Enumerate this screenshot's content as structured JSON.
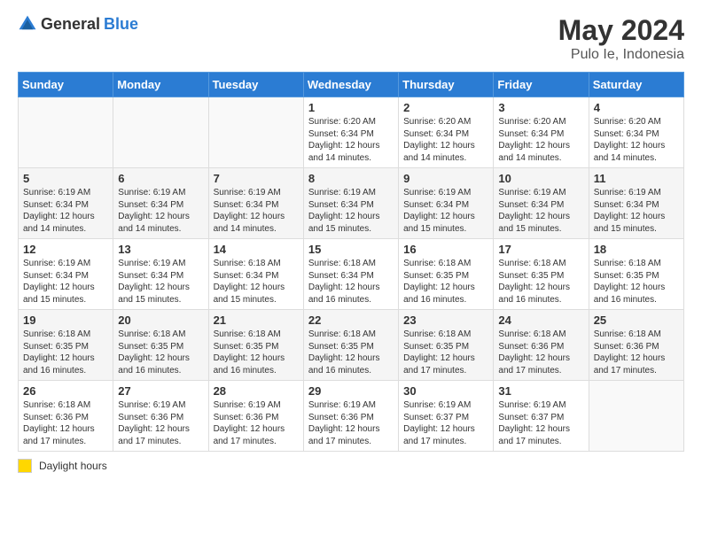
{
  "logo": {
    "general": "General",
    "blue": "Blue"
  },
  "title": "May 2024",
  "subtitle": "Pulo Ie, Indonesia",
  "days_header": [
    "Sunday",
    "Monday",
    "Tuesday",
    "Wednesday",
    "Thursday",
    "Friday",
    "Saturday"
  ],
  "weeks": [
    [
      {
        "day": "",
        "sunrise": "",
        "sunset": "",
        "daylight": ""
      },
      {
        "day": "",
        "sunrise": "",
        "sunset": "",
        "daylight": ""
      },
      {
        "day": "",
        "sunrise": "",
        "sunset": "",
        "daylight": ""
      },
      {
        "day": "1",
        "sunrise": "Sunrise: 6:20 AM",
        "sunset": "Sunset: 6:34 PM",
        "daylight": "Daylight: 12 hours and 14 minutes."
      },
      {
        "day": "2",
        "sunrise": "Sunrise: 6:20 AM",
        "sunset": "Sunset: 6:34 PM",
        "daylight": "Daylight: 12 hours and 14 minutes."
      },
      {
        "day": "3",
        "sunrise": "Sunrise: 6:20 AM",
        "sunset": "Sunset: 6:34 PM",
        "daylight": "Daylight: 12 hours and 14 minutes."
      },
      {
        "day": "4",
        "sunrise": "Sunrise: 6:20 AM",
        "sunset": "Sunset: 6:34 PM",
        "daylight": "Daylight: 12 hours and 14 minutes."
      }
    ],
    [
      {
        "day": "5",
        "sunrise": "Sunrise: 6:19 AM",
        "sunset": "Sunset: 6:34 PM",
        "daylight": "Daylight: 12 hours and 14 minutes."
      },
      {
        "day": "6",
        "sunrise": "Sunrise: 6:19 AM",
        "sunset": "Sunset: 6:34 PM",
        "daylight": "Daylight: 12 hours and 14 minutes."
      },
      {
        "day": "7",
        "sunrise": "Sunrise: 6:19 AM",
        "sunset": "Sunset: 6:34 PM",
        "daylight": "Daylight: 12 hours and 14 minutes."
      },
      {
        "day": "8",
        "sunrise": "Sunrise: 6:19 AM",
        "sunset": "Sunset: 6:34 PM",
        "daylight": "Daylight: 12 hours and 15 minutes."
      },
      {
        "day": "9",
        "sunrise": "Sunrise: 6:19 AM",
        "sunset": "Sunset: 6:34 PM",
        "daylight": "Daylight: 12 hours and 15 minutes."
      },
      {
        "day": "10",
        "sunrise": "Sunrise: 6:19 AM",
        "sunset": "Sunset: 6:34 PM",
        "daylight": "Daylight: 12 hours and 15 minutes."
      },
      {
        "day": "11",
        "sunrise": "Sunrise: 6:19 AM",
        "sunset": "Sunset: 6:34 PM",
        "daylight": "Daylight: 12 hours and 15 minutes."
      }
    ],
    [
      {
        "day": "12",
        "sunrise": "Sunrise: 6:19 AM",
        "sunset": "Sunset: 6:34 PM",
        "daylight": "Daylight: 12 hours and 15 minutes."
      },
      {
        "day": "13",
        "sunrise": "Sunrise: 6:19 AM",
        "sunset": "Sunset: 6:34 PM",
        "daylight": "Daylight: 12 hours and 15 minutes."
      },
      {
        "day": "14",
        "sunrise": "Sunrise: 6:18 AM",
        "sunset": "Sunset: 6:34 PM",
        "daylight": "Daylight: 12 hours and 15 minutes."
      },
      {
        "day": "15",
        "sunrise": "Sunrise: 6:18 AM",
        "sunset": "Sunset: 6:34 PM",
        "daylight": "Daylight: 12 hours and 16 minutes."
      },
      {
        "day": "16",
        "sunrise": "Sunrise: 6:18 AM",
        "sunset": "Sunset: 6:35 PM",
        "daylight": "Daylight: 12 hours and 16 minutes."
      },
      {
        "day": "17",
        "sunrise": "Sunrise: 6:18 AM",
        "sunset": "Sunset: 6:35 PM",
        "daylight": "Daylight: 12 hours and 16 minutes."
      },
      {
        "day": "18",
        "sunrise": "Sunrise: 6:18 AM",
        "sunset": "Sunset: 6:35 PM",
        "daylight": "Daylight: 12 hours and 16 minutes."
      }
    ],
    [
      {
        "day": "19",
        "sunrise": "Sunrise: 6:18 AM",
        "sunset": "Sunset: 6:35 PM",
        "daylight": "Daylight: 12 hours and 16 minutes."
      },
      {
        "day": "20",
        "sunrise": "Sunrise: 6:18 AM",
        "sunset": "Sunset: 6:35 PM",
        "daylight": "Daylight: 12 hours and 16 minutes."
      },
      {
        "day": "21",
        "sunrise": "Sunrise: 6:18 AM",
        "sunset": "Sunset: 6:35 PM",
        "daylight": "Daylight: 12 hours and 16 minutes."
      },
      {
        "day": "22",
        "sunrise": "Sunrise: 6:18 AM",
        "sunset": "Sunset: 6:35 PM",
        "daylight": "Daylight: 12 hours and 16 minutes."
      },
      {
        "day": "23",
        "sunrise": "Sunrise: 6:18 AM",
        "sunset": "Sunset: 6:35 PM",
        "daylight": "Daylight: 12 hours and 17 minutes."
      },
      {
        "day": "24",
        "sunrise": "Sunrise: 6:18 AM",
        "sunset": "Sunset: 6:36 PM",
        "daylight": "Daylight: 12 hours and 17 minutes."
      },
      {
        "day": "25",
        "sunrise": "Sunrise: 6:18 AM",
        "sunset": "Sunset: 6:36 PM",
        "daylight": "Daylight: 12 hours and 17 minutes."
      }
    ],
    [
      {
        "day": "26",
        "sunrise": "Sunrise: 6:18 AM",
        "sunset": "Sunset: 6:36 PM",
        "daylight": "Daylight: 12 hours and 17 minutes."
      },
      {
        "day": "27",
        "sunrise": "Sunrise: 6:19 AM",
        "sunset": "Sunset: 6:36 PM",
        "daylight": "Daylight: 12 hours and 17 minutes."
      },
      {
        "day": "28",
        "sunrise": "Sunrise: 6:19 AM",
        "sunset": "Sunset: 6:36 PM",
        "daylight": "Daylight: 12 hours and 17 minutes."
      },
      {
        "day": "29",
        "sunrise": "Sunrise: 6:19 AM",
        "sunset": "Sunset: 6:36 PM",
        "daylight": "Daylight: 12 hours and 17 minutes."
      },
      {
        "day": "30",
        "sunrise": "Sunrise: 6:19 AM",
        "sunset": "Sunset: 6:37 PM",
        "daylight": "Daylight: 12 hours and 17 minutes."
      },
      {
        "day": "31",
        "sunrise": "Sunrise: 6:19 AM",
        "sunset": "Sunset: 6:37 PM",
        "daylight": "Daylight: 12 hours and 17 minutes."
      },
      {
        "day": "",
        "sunrise": "",
        "sunset": "",
        "daylight": ""
      }
    ]
  ],
  "footer": {
    "legend_label": "Daylight hours"
  }
}
